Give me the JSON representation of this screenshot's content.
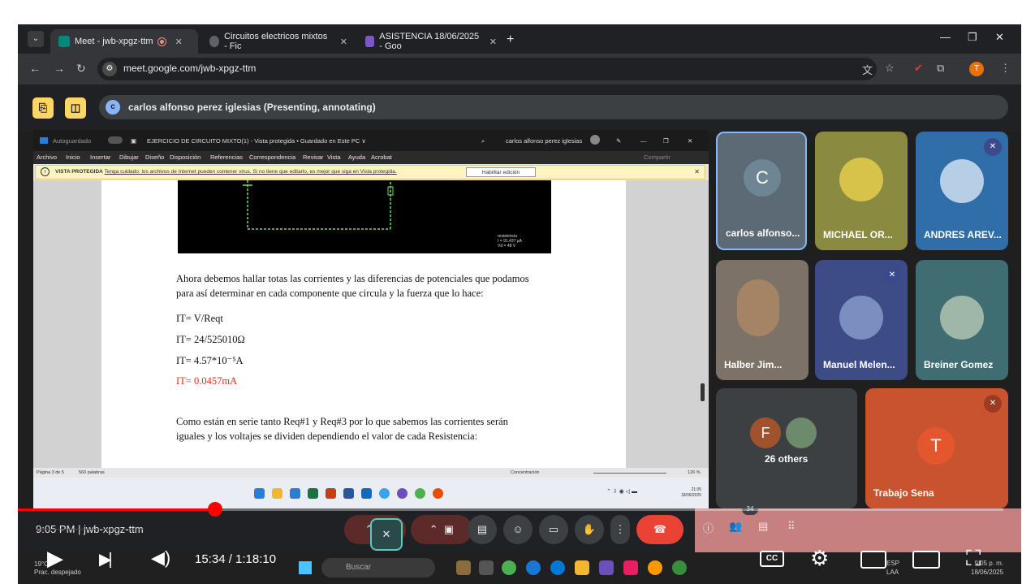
{
  "browser": {
    "tabs": [
      {
        "title": "Meet - jwb-xpgz-ttm"
      },
      {
        "title": "Circuitos electricos mixtos - Fic"
      },
      {
        "title": "ASISTENCIA 18/06/2025 - Goo"
      }
    ],
    "url": "meet.google.com/jwb-xpgz-ttm"
  },
  "meet": {
    "presenting_text": "carlos alfonso perez iglesias (Presenting, annotating)",
    "presenter_initial": "c",
    "time_meeting": "9:05 PM | jwb-xpgz-ttm",
    "participants_badge": "34",
    "tiles": [
      {
        "name": "carlos alfonso...",
        "initial": "C"
      },
      {
        "name": "MICHAEL OR..."
      },
      {
        "name": "ANDRES AREV..."
      },
      {
        "name": "Halber Jim..."
      },
      {
        "name": "Manuel Melen..."
      },
      {
        "name": "Breiner Gomez"
      },
      {
        "name": "26 others",
        "initial": "F"
      },
      {
        "name": "Trabajo Sena",
        "initial": "T"
      }
    ]
  },
  "word": {
    "autosave_label": "Autoguardado",
    "doc_title": "EJERCICIO DE CIRCUITO MIXTO(1) - Vista protegida • Guardado en Este PC ∨",
    "user_name": "carlos alfonso perez iglesias",
    "menu": [
      "Archivo",
      "Inicio",
      "Insertar",
      "Dibujar",
      "Diseño",
      "Disposición",
      "Referencias",
      "Correspondencia",
      "Revisar",
      "Vista",
      "Ayuda",
      "Acrobat"
    ],
    "share_label": "Compartir",
    "protected_label": "VISTA PROTEGIDA",
    "protected_msg": "Tenga cuidado: los archivos de Internet pueden contener virus. Si no tiene que editarlo, es mejor que siga en Vista protegida.",
    "enable_edit": "Habilitar edición",
    "circuit_info_1": "resistencia",
    "circuit_info_2": "I = 91.437 µA",
    "circuit_info_3": "Vd = 48 V",
    "para1_line1": "Ahora debemos hallar totas las corrientes y las diferencias de potenciales que podamos",
    "para1_line2": "para así determinar en cada componente que circula y la fuerza que lo hace:",
    "eq1": "IT= V/Reqt",
    "eq2": "IT= 24/525010Ω",
    "eq3": "IT= 4.57*10⁻⁵A",
    "eq4": "IT= 0.0457mA",
    "para2_line1": "Como están en serie tanto Req#1 y Req#3 por lo que sabemos las corrientes serán",
    "para2_line2": "iguales y los voltajes se dividen dependiendo el valor de cada Resistencia:",
    "status_page": "Página 3 de 5",
    "status_words": "560 palabras",
    "status_focus": "Concentración",
    "zoom": "126 %",
    "inner_time": "21:05",
    "inner_date": "18/06/2025"
  },
  "windows": {
    "weather_line1": "19°C",
    "weather_line2": "Prac. despejado",
    "search_placeholder": "Buscar",
    "lang_1": "ESP",
    "lang_2": "LAA",
    "clock_time": "9:05 p. m.",
    "clock_date": "18/06/2025"
  },
  "youtube": {
    "time": "15:34 / 1:18:10",
    "progress_fraction": 0.2
  },
  "colors": {
    "meet_bg": "#202124",
    "accent_yellow": "#fdd663",
    "end_call": "#ea4335",
    "yt_red": "#ff0000"
  }
}
